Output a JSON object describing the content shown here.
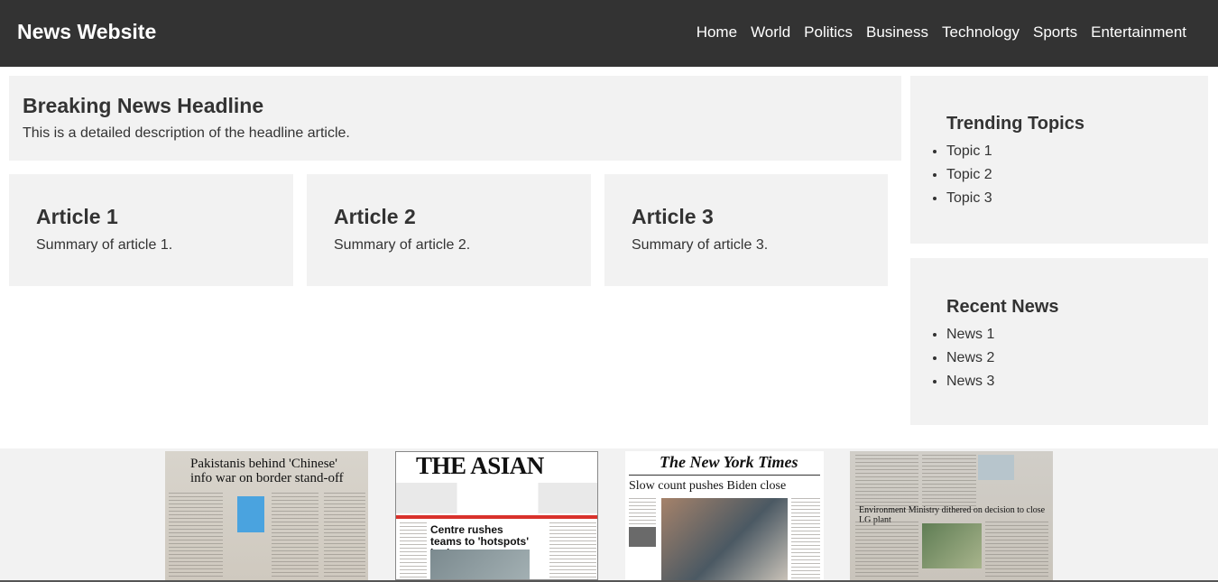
{
  "header": {
    "brand": "News Website",
    "nav": [
      "Home",
      "World",
      "Politics",
      "Business",
      "Technology",
      "Sports",
      "Entertainment"
    ]
  },
  "hero": {
    "title": "Breaking News Headline",
    "description": "This is a detailed description of the headline article."
  },
  "articles": [
    {
      "title": "Article 1",
      "summary": "Summary of article 1."
    },
    {
      "title": "Article 2",
      "summary": "Summary of article 2."
    },
    {
      "title": "Article 3",
      "summary": "Summary of article 3."
    }
  ],
  "sidebar": {
    "trending": {
      "title": "Trending Topics",
      "items": [
        "Topic 1",
        "Topic 2",
        "Topic 3"
      ]
    },
    "recent": {
      "title": "Recent News",
      "items": [
        "News 1",
        "News 2",
        "News 3"
      ]
    }
  },
  "newspapers": [
    {
      "headline": "Pakistanis behind 'Chinese' info war on border stand-off"
    },
    {
      "masthead": "THE ASIAN AGE",
      "headline": "Centre rushes teams to 'hotspots' in three states"
    },
    {
      "masthead": "The New York Times",
      "headline": "Slow count pushes Biden close"
    },
    {
      "headline": "Environment Ministry dithered on decision to close LG plant"
    }
  ]
}
